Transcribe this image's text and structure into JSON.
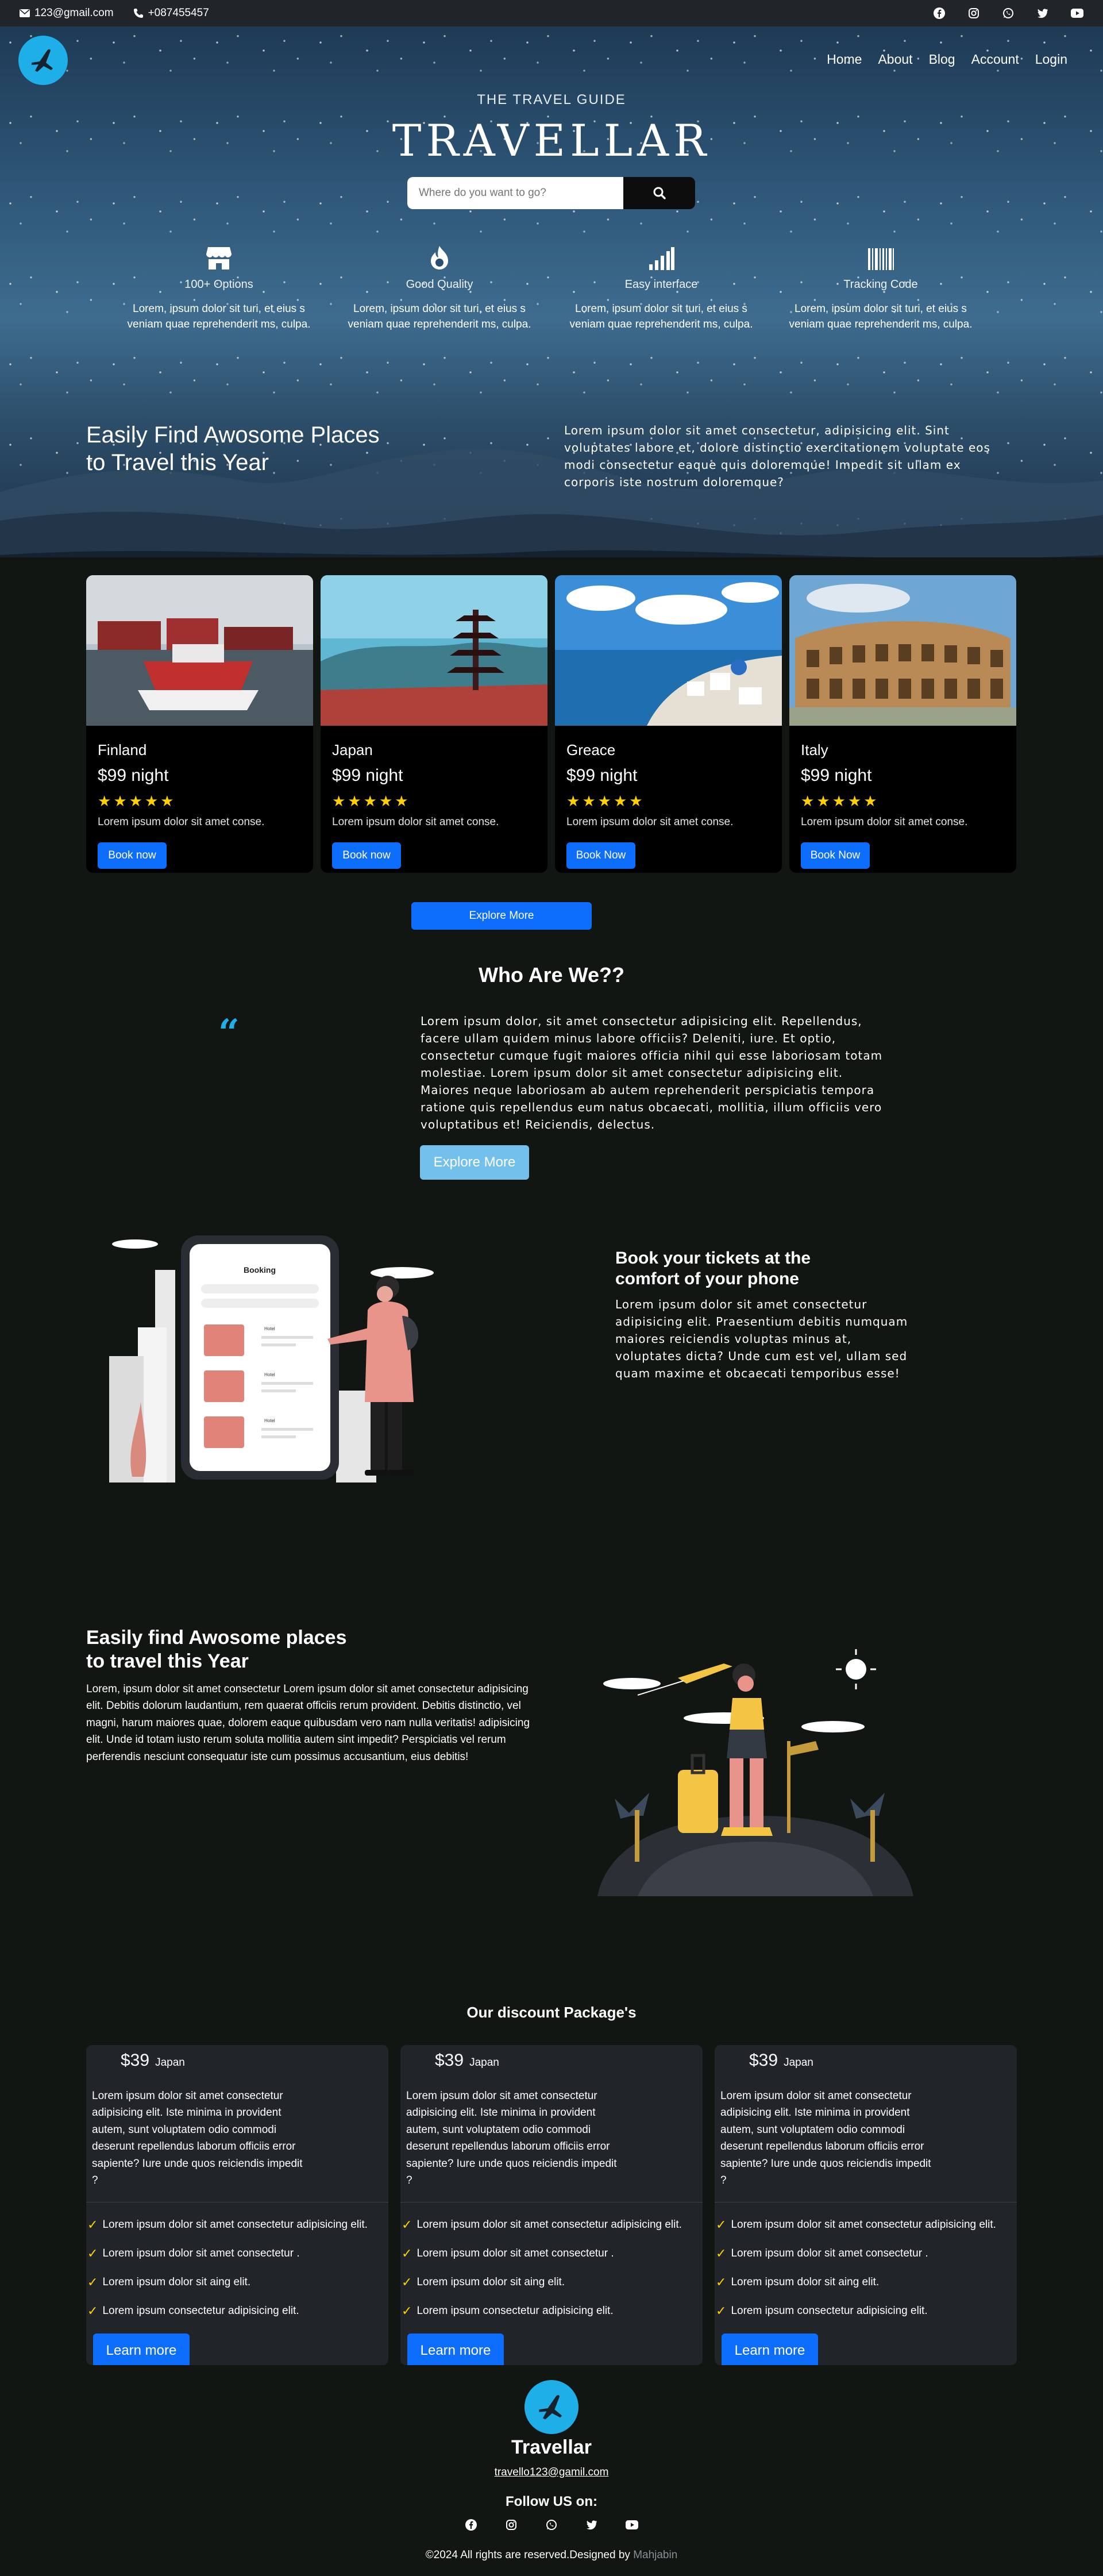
{
  "topbar": {
    "email": "123@gmail.com",
    "phone": "+087455457",
    "socials": [
      "facebook-icon",
      "instagram-icon",
      "whatsapp-icon",
      "twitter-icon",
      "youtube-icon"
    ]
  },
  "nav": {
    "items": [
      "Home",
      "About",
      "Blog",
      "Account",
      "Login"
    ]
  },
  "hero": {
    "subtitle": "THE TRAVEL GUIDE",
    "title": "TRAVELLAR",
    "search_placeholder": "Where do you want to go?",
    "features": [
      {
        "icon": "store-icon",
        "title": "100+ Options",
        "desc": "Lorem, ipsum dolor sit turi, et eius s veniam quae reprehenderit ms, culpa."
      },
      {
        "icon": "flame-icon",
        "title": "Good Quality",
        "desc": "Lorem, ipsum dolor sit turi, et eius s veniam quae reprehenderit ms, culpa."
      },
      {
        "icon": "signal-icon",
        "title": "Easy interface",
        "desc": "Lorem, ipsum dolor sit turi, et eius s veniam quae reprehenderit ms, culpa."
      },
      {
        "icon": "barcode-icon",
        "title": "Tracking Code",
        "desc": "Lorem, ipsum dolor sit turi, et eius s veniam quae reprehenderit ms, culpa."
      }
    ],
    "heading_line1": "Easily Find Awosome Places",
    "heading_line2": "to Travel this Year",
    "paragraph": "Lorem ipsum dolor sit amet consectetur, adipisicing elit. Sint voluptates labore et, dolore distinctio exercitationem voluptate eos modi consectetur eaque quis doloremque! Impedit sit ullam ex corporis iste nostrum doloremque?"
  },
  "destinations": [
    {
      "city": "Finland",
      "price": "$99 night",
      "rating": 5,
      "desc": "Lorem ipsum dolor sit amet conse.",
      "button": "Book now"
    },
    {
      "city": "Japan",
      "price": "$99 night",
      "rating": 5,
      "desc": "Lorem ipsum dolor sit amet conse.",
      "button": "Book now"
    },
    {
      "city": "Greace",
      "price": "$99 night",
      "rating": 5,
      "desc": "Lorem ipsum dolor sit amet conse.",
      "button": "Book Now"
    },
    {
      "city": "Italy",
      "price": "$99 night",
      "rating": 5,
      "desc": "Lorem ipsum dolor sit amet conse.",
      "button": "Book Now"
    }
  ],
  "explore_more": "Explore More",
  "who": {
    "title": "Who Are We??",
    "quote_mark": "“",
    "paragraph": "Lorem ipsum dolor, sit amet consectetur adipisicing elit. Repellendus, facere ullam quidem minus labore officiis? Deleniti, iure. Et optio, consectetur cumque fugit maiores officia nihil qui esse laboriosam totam molestiae. Lorem ipsum dolor sit amet consectetur adipisicing elit. Maiores neque laboriosam ab autem reprehenderit perspiciatis tempora ratione quis repellendus eum natus obcaecati, mollitia, illum officiis vero voluptatibus et! Reiciendis, delectus.",
    "button": "Explore More"
  },
  "booking": {
    "heading_line1": "Book your tickets at the",
    "heading_line2": "comfort of your phone",
    "paragraph": "Lorem ipsum dolor sit amet consectetur adipisicing elit. Praesentium debitis numquam maiores reiciendis voluptas minus at, voluptates dicta? Unde cum est vel, ullam sed quam maxime et obcaecati temporibus esse!",
    "phone_title": "Booking",
    "phone_labels": [
      "Hotel",
      "Hotel",
      "Hotel"
    ]
  },
  "find": {
    "heading_line1": "Easily find Awosome places",
    "heading_line2": "to travel this Year",
    "paragraph": "Lorem, ipsum dolor sit amet consectetur Lorem ipsum dolor sit amet consectetur adipisicing elit. Debitis dolorum laudantium, rem quaerat officiis rerum provident. Debitis distinctio, vel magni, harum maiores quae, dolorem eaque quibusdam vero nam nulla veritatis! adipisicing elit. Unde id totam iusto rerum soluta mollitia autem sint impedit? Perspiciatis vel rerum perferendis nesciunt consequatur iste cum possimus accusantium, eius debitis!"
  },
  "discount": {
    "title": "Our discount Package's",
    "packages": [
      {
        "price": "$39",
        "location": "Japan",
        "desc": "Lorem ipsum dolor sit amet consectetur adipisicing elit. Iste minima in provident autem, sunt voluptatem odio commodi deserunt repellendus laborum officiis error sapiente? Iure unde quos reiciendis impedit ?",
        "features": [
          "Lorem ipsum dolor sit amet consectetur adipisicing elit.",
          "Lorem ipsum dolor sit amet consectetur .",
          "Lorem ipsum dolor sit aing elit.",
          "Lorem ipsum consectetur adipisicing elit."
        ],
        "button": "Learn more"
      },
      {
        "price": "$39",
        "location": "Japan",
        "desc": "Lorem ipsum dolor sit amet consectetur adipisicing elit. Iste minima in provident autem, sunt voluptatem odio commodi deserunt repellendus laborum officiis error sapiente? Iure unde quos reiciendis impedit ?",
        "features": [
          "Lorem ipsum dolor sit amet consectetur adipisicing elit.",
          "Lorem ipsum dolor sit amet consectetur .",
          "Lorem ipsum dolor sit aing elit.",
          "Lorem ipsum consectetur adipisicing elit."
        ],
        "button": "Learn more"
      },
      {
        "price": "$39",
        "location": "Japan",
        "desc": "Lorem ipsum dolor sit amet consectetur adipisicing elit. Iste minima in provident autem, sunt voluptatem odio commodi deserunt repellendus laborum officiis error sapiente? Iure unde quos reiciendis impedit ?",
        "features": [
          "Lorem ipsum dolor sit amet consectetur adipisicing elit.",
          "Lorem ipsum dolor sit amet consectetur .",
          "Lorem ipsum dolor sit aing elit.",
          "Lorem ipsum consectetur adipisicing elit."
        ],
        "button": "Learn more"
      }
    ]
  },
  "footer": {
    "name": "Travellar",
    "email": "travello123@gamil.com",
    "follow": "Follow US on:",
    "copyright": "©2024 All rights are reserved.Designed by ",
    "designer": "Mahjabin"
  },
  "colors": {
    "accent": "#0d6efd",
    "brand": "#1eaee8",
    "background": "#111613",
    "card": "#212529",
    "star": "#ffd000"
  }
}
